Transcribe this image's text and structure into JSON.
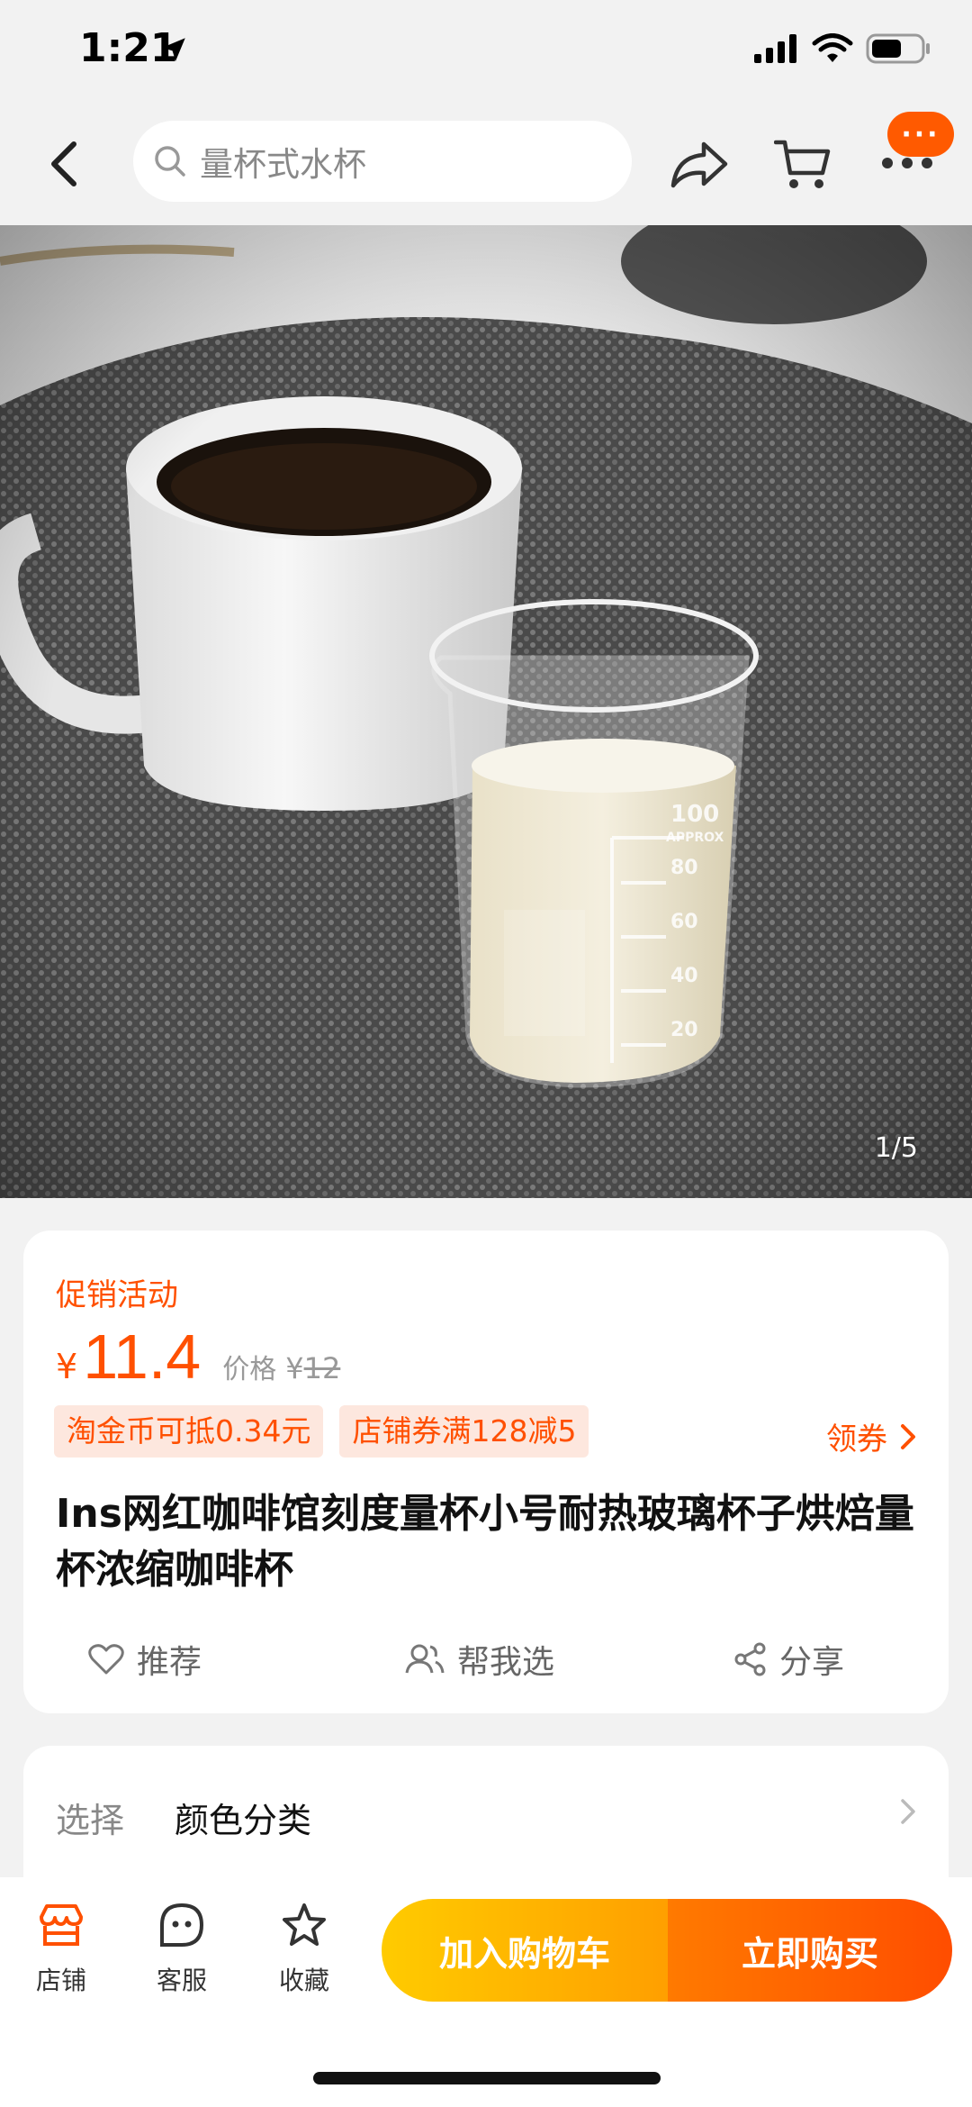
{
  "status_bar": {
    "time": "1:21"
  },
  "header": {
    "search_placeholder": "量杯式水杯",
    "message_badge": "···"
  },
  "hero": {
    "image_counter": "1/5"
  },
  "product": {
    "promo_label": "促销活动",
    "price_symbol": "¥",
    "price": "11.4",
    "original_price_label": "价格",
    "original_price_symbol": "¥",
    "original_price": "12",
    "tags": [
      "淘金币可抵0.34元",
      "店铺券满128减5"
    ],
    "coupon_link": "领券",
    "title": "Ins网红咖啡馆刻度量杯小号耐热玻璃杯子烘焙量杯浓缩咖啡杯",
    "actions": {
      "recommend": "推荐",
      "help_choose": "帮我选",
      "share": "分享"
    }
  },
  "options": {
    "label": "选择",
    "value": "颜色分类"
  },
  "bottom_bar": {
    "shop": "店铺",
    "service": "客服",
    "favorite": "收藏",
    "add_to_cart": "加入购物车",
    "buy_now": "立即购买"
  },
  "colors": {
    "accent": "#ff5000",
    "cart_button": "#ffb300",
    "buy_button": "#ff5a00"
  }
}
